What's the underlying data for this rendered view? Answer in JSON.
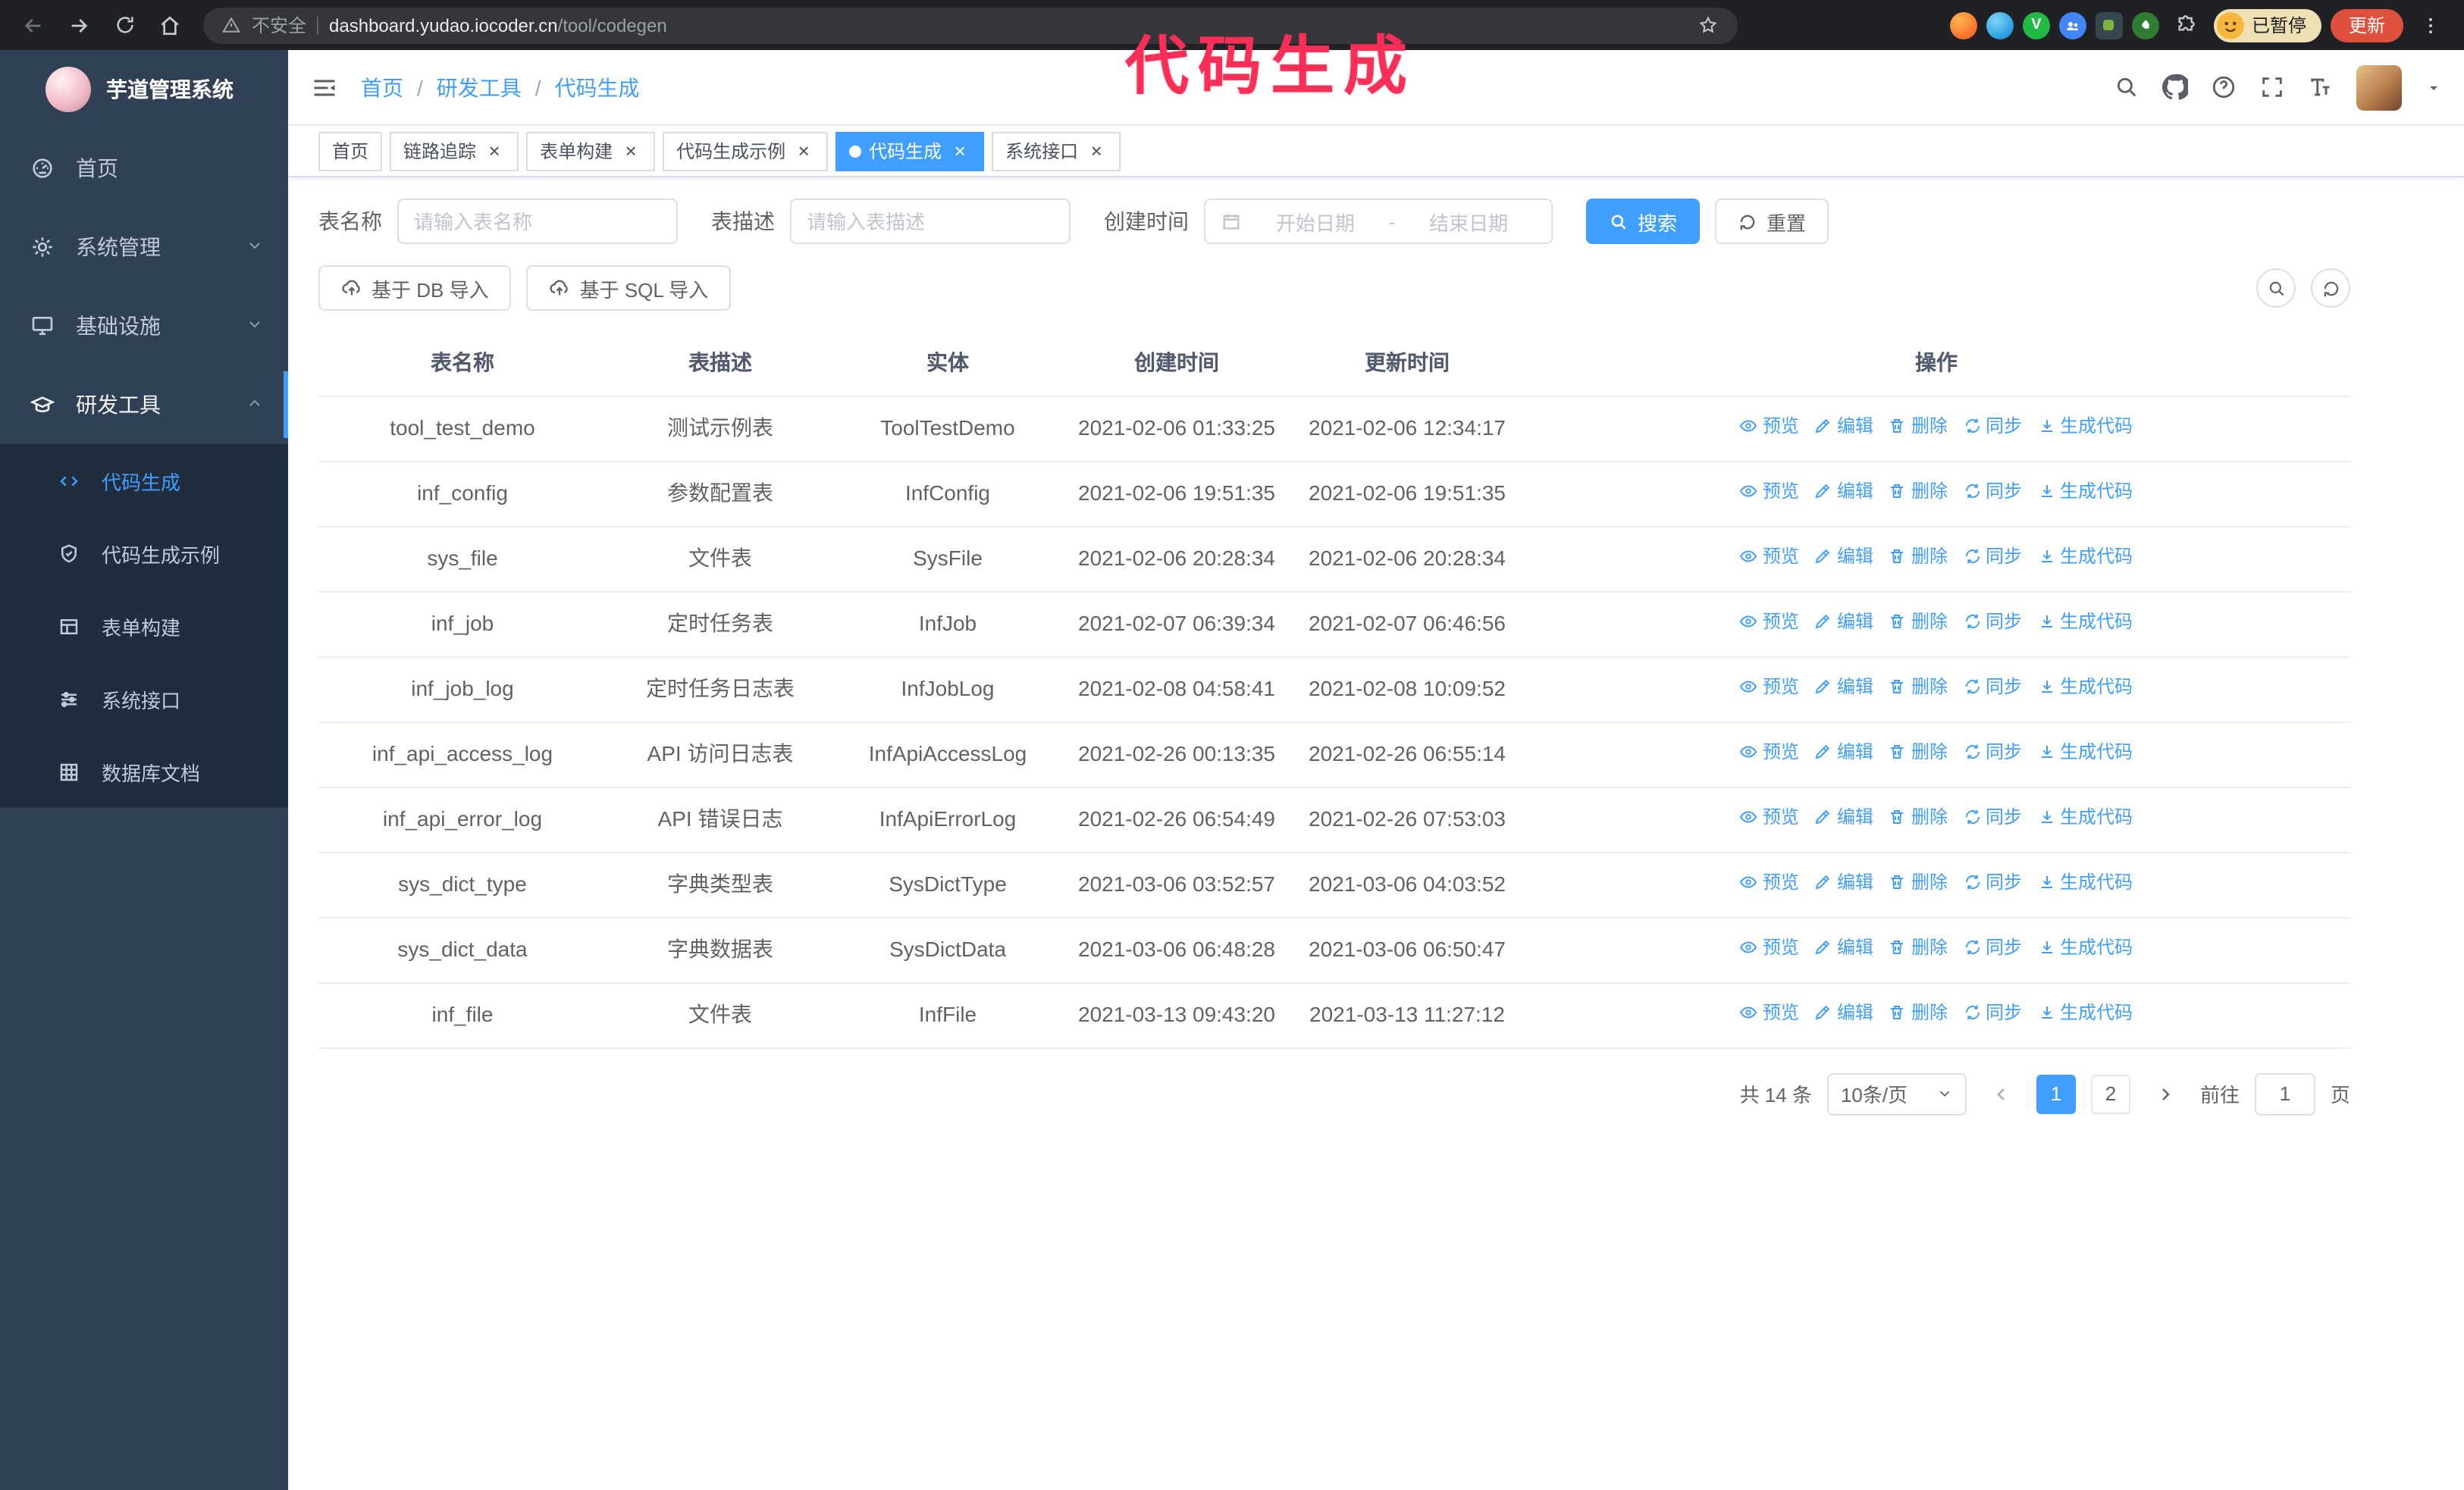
{
  "colors": {
    "accent": "#409eff",
    "sidebar_bg": "#304156",
    "submenu_bg": "#1f2d3d",
    "annotation": "#fb2e57",
    "update_button": "#e0503f",
    "browser_bar": "#202124"
  },
  "annotation": {
    "text": "代码生成"
  },
  "browser": {
    "security_label": "不安全",
    "url_host": "dashboard.yudao.iocoder.cn",
    "url_path": "/tool/codegen",
    "profile_badge": "已暂停",
    "update_button": "更新",
    "ext3_glyph": "V"
  },
  "icons": {
    "tab_close": "×",
    "breadcrumb_separator": "/"
  },
  "sidebar": {
    "app_title": "芋道管理系统",
    "items": [
      {
        "label": "首页"
      },
      {
        "label": "系统管理"
      },
      {
        "label": "基础设施"
      },
      {
        "label": "研发工具",
        "expanded": true
      }
    ],
    "submenu": [
      {
        "label": "代码生成",
        "active": true
      },
      {
        "label": "代码生成示例"
      },
      {
        "label": "表单构建"
      },
      {
        "label": "系统接口"
      },
      {
        "label": "数据库文档"
      }
    ]
  },
  "breadcrumb": [
    "首页",
    "研发工具",
    "代码生成"
  ],
  "tabs": [
    {
      "label": "首页",
      "closable": false,
      "active": false
    },
    {
      "label": "链路追踪",
      "closable": true,
      "active": false
    },
    {
      "label": "表单构建",
      "closable": true,
      "active": false
    },
    {
      "label": "代码生成示例",
      "closable": true,
      "active": false
    },
    {
      "label": "代码生成",
      "closable": true,
      "active": true
    },
    {
      "label": "系统接口",
      "closable": true,
      "active": false
    }
  ],
  "filters": {
    "name_label": "表名称",
    "name_placeholder": "请输入表名称",
    "desc_label": "表描述",
    "desc_placeholder": "请输入表描述",
    "time_label": "创建时间",
    "start_placeholder": "开始日期",
    "range_separator": "-",
    "end_placeholder": "结束日期",
    "search_label": "搜索",
    "reset_label": "重置"
  },
  "toolbar": {
    "import_db_label": "基于 DB 导入",
    "import_sql_label": "基于 SQL 导入"
  },
  "table": {
    "columns": [
      "表名称",
      "表描述",
      "实体",
      "创建时间",
      "更新时间",
      "操作"
    ],
    "action_labels": {
      "preview": "预览",
      "edit": "编辑",
      "delete": "删除",
      "sync": "同步",
      "generate": "生成代码"
    },
    "rows": [
      {
        "name": "tool_test_demo",
        "desc": "测试示例表",
        "entity": "ToolTestDemo",
        "created": "2021-02-06 01:33:25",
        "updated": "2021-02-06 12:34:17"
      },
      {
        "name": "inf_config",
        "desc": "参数配置表",
        "entity": "InfConfig",
        "created": "2021-02-06 19:51:35",
        "updated": "2021-02-06 19:51:35"
      },
      {
        "name": "sys_file",
        "desc": "文件表",
        "entity": "SysFile",
        "created": "2021-02-06 20:28:34",
        "updated": "2021-02-06 20:28:34"
      },
      {
        "name": "inf_job",
        "desc": "定时任务表",
        "entity": "InfJob",
        "created": "2021-02-07 06:39:34",
        "updated": "2021-02-07 06:46:56"
      },
      {
        "name": "inf_job_log",
        "desc": "定时任务日志表",
        "entity": "InfJobLog",
        "created": "2021-02-08 04:58:41",
        "updated": "2021-02-08 10:09:52"
      },
      {
        "name": "inf_api_access_log",
        "desc": "API 访问日志表",
        "entity": "InfApiAccessLog",
        "created": "2021-02-26 00:13:35",
        "updated": "2021-02-26 06:55:14"
      },
      {
        "name": "inf_api_error_log",
        "desc": "API 错误日志",
        "entity": "InfApiErrorLog",
        "created": "2021-02-26 06:54:49",
        "updated": "2021-02-26 07:53:03"
      },
      {
        "name": "sys_dict_type",
        "desc": "字典类型表",
        "entity": "SysDictType",
        "created": "2021-03-06 03:52:57",
        "updated": "2021-03-06 04:03:52"
      },
      {
        "name": "sys_dict_data",
        "desc": "字典数据表",
        "entity": "SysDictData",
        "created": "2021-03-06 06:48:28",
        "updated": "2021-03-06 06:50:47"
      },
      {
        "name": "inf_file",
        "desc": "文件表",
        "entity": "InfFile",
        "created": "2021-03-13 09:43:20",
        "updated": "2021-03-13 11:27:12"
      }
    ]
  },
  "pagination": {
    "total_text": "共 14 条",
    "page_size": "10条/页",
    "pages": [
      "1",
      "2"
    ],
    "active_page": "1",
    "goto_label": "前往",
    "goto_value": "1",
    "page_unit": "页"
  }
}
